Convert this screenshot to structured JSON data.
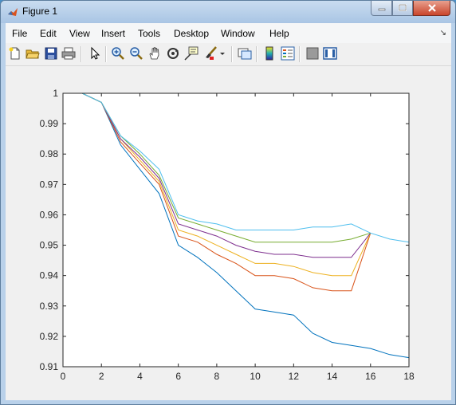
{
  "window": {
    "title": "Figure 1",
    "controls": {
      "minimize": "minimize",
      "maximize": "maximize",
      "close": "close"
    }
  },
  "menu": {
    "items": [
      "File",
      "Edit",
      "View",
      "Insert",
      "Tools",
      "Desktop",
      "Window",
      "Help"
    ]
  },
  "toolbar": {
    "icons": [
      "new-figure-icon",
      "open-file-icon",
      "save-icon",
      "print-icon",
      "edit-plot-arrow-icon",
      "zoom-in-icon",
      "zoom-out-icon",
      "pan-hand-icon",
      "rotate-3d-icon",
      "data-cursor-icon",
      "brush-icon",
      "brush-dropdown-icon",
      "link-plot-icon",
      "colorbar-icon",
      "legend-icon",
      "hide-plot-tools-icon",
      "show-plot-tools-icon"
    ]
  },
  "colors": {
    "series": [
      "#0072BD",
      "#D95319",
      "#EDB120",
      "#7E2F8E",
      "#77AC30",
      "#4DBEEE"
    ]
  },
  "chart_data": {
    "type": "line",
    "title": "",
    "xlabel": "",
    "ylabel": "",
    "xlim": [
      0,
      18
    ],
    "ylim": [
      0.91,
      1.0
    ],
    "xticks": [
      0,
      2,
      4,
      6,
      8,
      10,
      12,
      14,
      16,
      18
    ],
    "yticks": [
      0.91,
      0.92,
      0.93,
      0.94,
      0.95,
      0.96,
      0.97,
      0.98,
      0.99,
      1
    ],
    "ytick_labels": [
      "0.91",
      "0.92",
      "0.93",
      "0.94",
      "0.95",
      "0.96",
      "0.97",
      "0.98",
      "0.99",
      "1"
    ],
    "grid": false,
    "series": [
      {
        "x": [
          1,
          2,
          3,
          4,
          5,
          6,
          7,
          8,
          9,
          10,
          11,
          12,
          13,
          14,
          15,
          16,
          17,
          18
        ],
        "values": [
          1.0,
          0.997,
          0.983,
          0.975,
          0.967,
          0.95,
          0.946,
          0.941,
          0.935,
          0.929,
          0.928,
          0.927,
          0.921,
          0.918,
          0.917,
          0.916,
          0.914,
          0.913
        ]
      },
      {
        "x": [
          1,
          2,
          3,
          4,
          5,
          6,
          7,
          8,
          9,
          10,
          11,
          12,
          13,
          14,
          15,
          16
        ],
        "values": [
          1.0,
          0.997,
          0.984,
          0.977,
          0.97,
          0.953,
          0.951,
          0.947,
          0.944,
          0.94,
          0.94,
          0.939,
          0.936,
          0.935,
          0.935,
          0.954
        ]
      },
      {
        "x": [
          1,
          2,
          3,
          4,
          5,
          6,
          7,
          8,
          9,
          10,
          11,
          12,
          13,
          14,
          15,
          16
        ],
        "values": [
          1.0,
          0.997,
          0.985,
          0.978,
          0.971,
          0.955,
          0.953,
          0.95,
          0.947,
          0.944,
          0.944,
          0.943,
          0.941,
          0.94,
          0.94,
          0.954
        ]
      },
      {
        "x": [
          1,
          2,
          3,
          4,
          5,
          6,
          7,
          8,
          9,
          10,
          11,
          12,
          13,
          14,
          15,
          16
        ],
        "values": [
          1.0,
          0.997,
          0.985,
          0.979,
          0.972,
          0.957,
          0.955,
          0.953,
          0.95,
          0.948,
          0.947,
          0.947,
          0.946,
          0.946,
          0.946,
          0.954
        ]
      },
      {
        "x": [
          1,
          2,
          3,
          4,
          5,
          6,
          7,
          8,
          9,
          10,
          11,
          12,
          13,
          14,
          15,
          16
        ],
        "values": [
          1.0,
          0.997,
          0.986,
          0.98,
          0.973,
          0.959,
          0.957,
          0.955,
          0.953,
          0.951,
          0.951,
          0.951,
          0.951,
          0.951,
          0.952,
          0.954
        ]
      },
      {
        "x": [
          1,
          2,
          3,
          4,
          5,
          6,
          7,
          8,
          9,
          10,
          11,
          12,
          13,
          14,
          15,
          16,
          17,
          18
        ],
        "values": [
          1.0,
          0.997,
          0.986,
          0.981,
          0.975,
          0.96,
          0.958,
          0.957,
          0.955,
          0.955,
          0.955,
          0.955,
          0.956,
          0.956,
          0.957,
          0.954,
          0.952,
          0.951
        ]
      }
    ]
  }
}
